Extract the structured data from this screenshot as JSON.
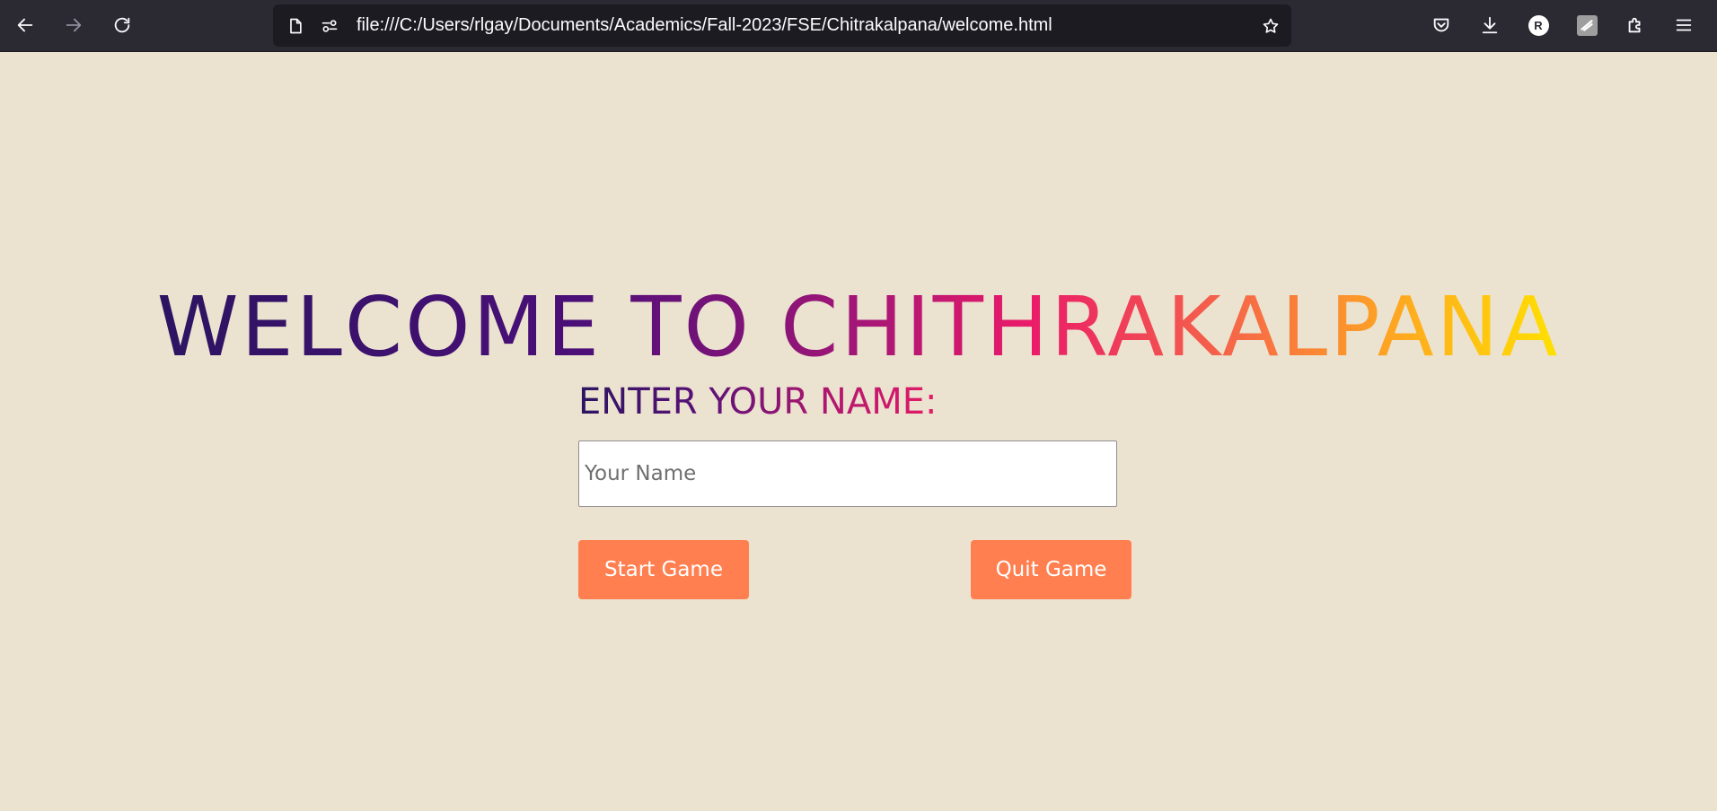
{
  "browser": {
    "url": "file:///C:/Users/rlgay/Documents/Academics/Fall-2023/FSE/Chitrakalpana/welcome.html",
    "avatar_letter": "R",
    "icons": [
      "back-icon",
      "forward-icon",
      "reload-icon",
      "page-icon",
      "permissions-icon",
      "bookmark-star-icon",
      "pocket-icon",
      "download-icon",
      "account-icon",
      "extension-icon",
      "extensions-puzzle-icon",
      "menu-icon"
    ]
  },
  "page": {
    "title": "WELCOME TO CHITHRAKALPANA",
    "name_label": "ENTER YOUR NAME:",
    "name_input": {
      "placeholder": "Your Name",
      "value": ""
    },
    "start_button": "Start Game",
    "quit_button": "Quit Game"
  },
  "colors": {
    "background": "#ebe3d0",
    "button": "#ff7f50",
    "title_gradient_start": "#2c1461",
    "title_gradient_end": "#ffe100"
  }
}
